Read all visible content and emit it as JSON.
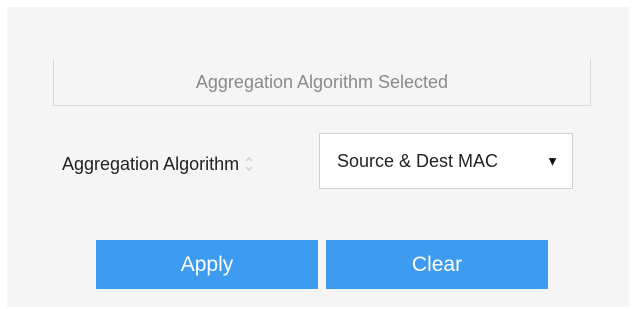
{
  "section": {
    "header": "Aggregation Algorithm Selected"
  },
  "form": {
    "label": "Aggregation Algorithm",
    "select_value": "Source & Dest MAC",
    "select_arrow": "▼"
  },
  "buttons": {
    "apply": "Apply",
    "clear": "Clear"
  },
  "colors": {
    "panel_background": "#f5f5f5",
    "button": "#3d9cf0",
    "header_text": "#8a8a8a"
  },
  "icons": {
    "sort": "sort-icon",
    "dropdown": "chevron-down-icon"
  }
}
